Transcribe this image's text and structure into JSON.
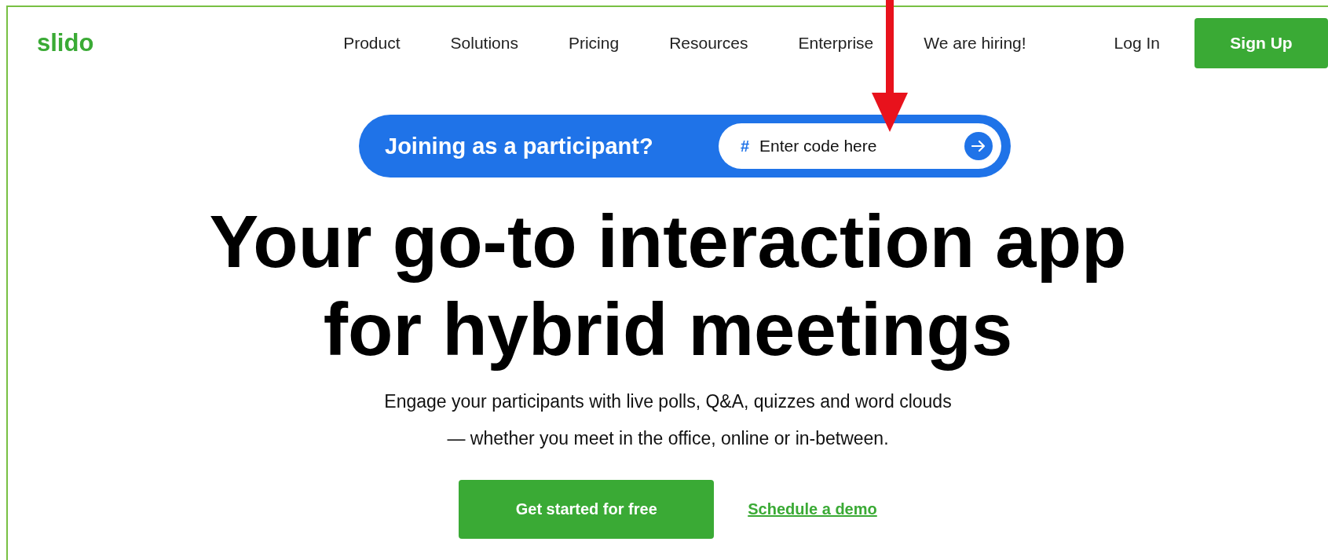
{
  "header": {
    "logo": "slido",
    "nav": [
      "Product",
      "Solutions",
      "Pricing",
      "Resources",
      "Enterprise",
      "We are hiring!"
    ],
    "login": "Log In",
    "signup": "Sign Up"
  },
  "join_bar": {
    "label": "Joining as a participant?",
    "hash": "#",
    "placeholder": "Enter code here"
  },
  "hero": {
    "title_lines": [
      "Your go-to interaction app",
      "for hybrid meetings"
    ],
    "subtitle_lines": [
      "Engage your participants with live polls, Q&A, quizzes and word clouds",
      "— whether you meet in the office, online or in-between."
    ],
    "primary_button": "Get started for free",
    "secondary_link": "Schedule a demo"
  },
  "annotation": {
    "kind": "arrow"
  }
}
